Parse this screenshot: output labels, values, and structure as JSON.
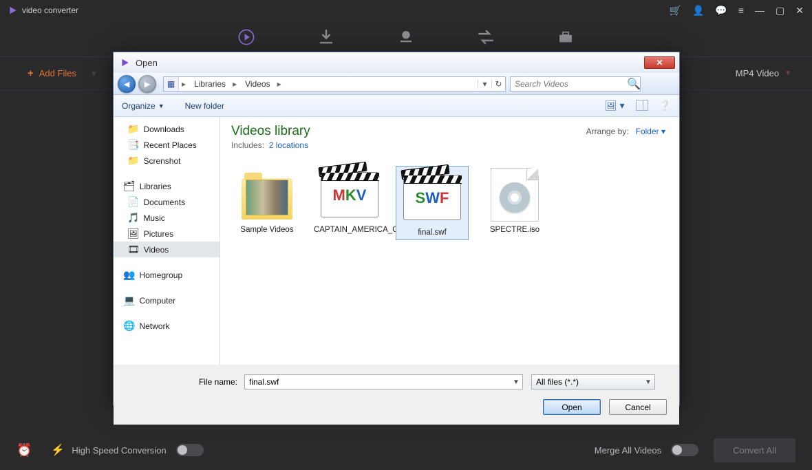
{
  "app": {
    "title": "video converter",
    "titlebar_icons": [
      "cart-icon",
      "user-icon",
      "message-icon",
      "menu-icon",
      "minimize-icon",
      "maximize-icon",
      "close-icon"
    ]
  },
  "secondbar": {
    "add_files": "Add Files",
    "output_format": "MP4 Video"
  },
  "bottombar": {
    "high_speed": "High Speed Conversion",
    "merge": "Merge All Videos",
    "convert_all": "Convert All"
  },
  "dialog": {
    "title": "Open",
    "breadcrumbs": [
      "Libraries",
      "Videos"
    ],
    "search_placeholder": "Search Videos",
    "toolbar": {
      "organize": "Organize",
      "new_folder": "New folder"
    },
    "tree": {
      "leafs": [
        "Downloads",
        "Recent Places",
        "Screnshot"
      ],
      "libraries_label": "Libraries",
      "libraries": [
        "Documents",
        "Music",
        "Pictures",
        "Videos"
      ],
      "selected": "Videos",
      "homegroup": "Homegroup",
      "computer": "Computer",
      "network": "Network"
    },
    "content": {
      "title": "Videos library",
      "includes_label": "Includes:",
      "includes_link": "2 locations",
      "arrange_label": "Arrange by:",
      "arrange_value": "Folder",
      "files": [
        {
          "name": "Sample Videos",
          "kind": "folder"
        },
        {
          "name": "CAPTAIN_AMERICA_CIVIL_WAR.mkv",
          "kind": "mkv"
        },
        {
          "name": "final.swf",
          "kind": "swf",
          "selected": true
        },
        {
          "name": "SPECTRE.iso",
          "kind": "iso"
        }
      ]
    },
    "footer": {
      "filename_label": "File name:",
      "filename_value": "final.swf",
      "filter": "All files (*.*)",
      "open": "Open",
      "cancel": "Cancel"
    }
  }
}
